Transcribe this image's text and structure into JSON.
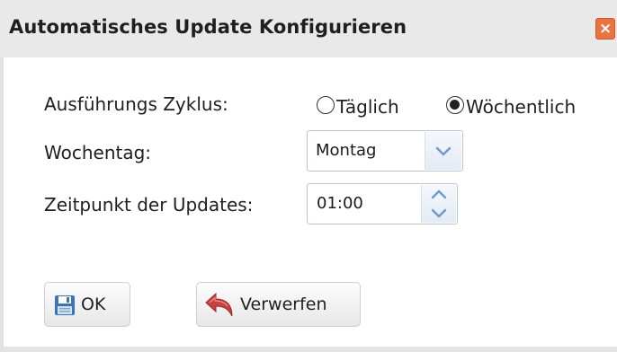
{
  "dialog": {
    "title": "Automatisches Update Konfigurieren",
    "close_glyph": "×",
    "close_color": "#e9743f"
  },
  "cycle": {
    "label": "Ausführungs Zyklus:",
    "options": [
      {
        "label": "Täglich",
        "selected": false
      },
      {
        "label": "Wöchentlich",
        "selected": true
      }
    ]
  },
  "weekday": {
    "label": "Wochentag:",
    "value": "Montag",
    "icon": "chevron-down-icon"
  },
  "time": {
    "label": "Zeitpunkt der Updates:",
    "value": "01:00",
    "icons": [
      "chevron-up-icon",
      "chevron-down-icon"
    ]
  },
  "buttons": {
    "ok_label": "OK",
    "ok_icon": "floppy-disk-icon",
    "cancel_label": "Verwerfen",
    "cancel_icon": "undo-arrow-icon"
  },
  "colors": {
    "accent": "#7da7d9",
    "titlebar": "#e9e9e9",
    "close": "#e9743f"
  }
}
